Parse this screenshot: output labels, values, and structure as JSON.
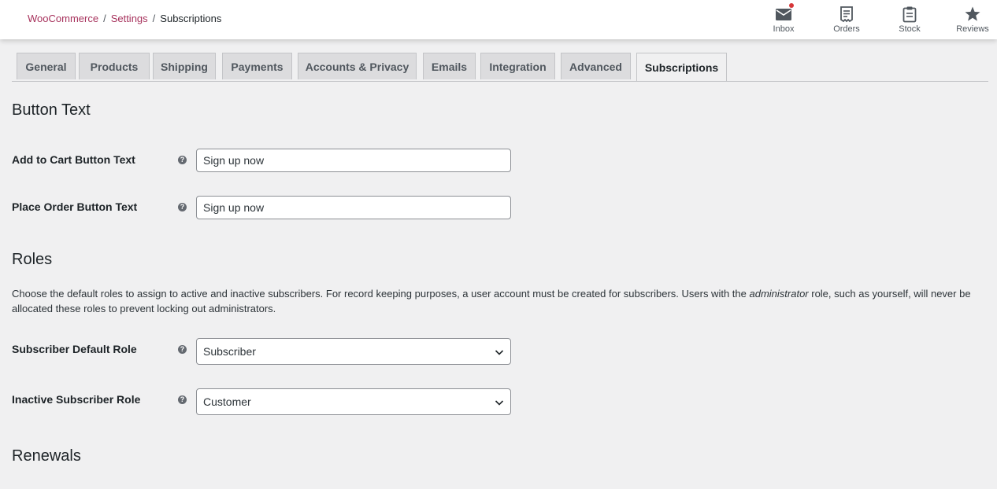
{
  "header": {
    "breadcrumb": {
      "woocommerce": "WooCommerce",
      "settings": "Settings",
      "current": "Subscriptions",
      "separator": "/"
    },
    "activity": [
      {
        "label": "Inbox",
        "icon": "inbox-icon",
        "has_unread": true
      },
      {
        "label": "Orders",
        "icon": "orders-icon"
      },
      {
        "label": "Stock",
        "icon": "stock-icon"
      },
      {
        "label": "Reviews",
        "icon": "star-icon"
      }
    ]
  },
  "tabs": [
    {
      "label": "General"
    },
    {
      "label": "Products"
    },
    {
      "label": "Shipping"
    },
    {
      "label": "Payments"
    },
    {
      "label": "Accounts & Privacy"
    },
    {
      "label": "Emails"
    },
    {
      "label": "Integration"
    },
    {
      "label": "Advanced"
    },
    {
      "label": "Subscriptions",
      "active": true
    }
  ],
  "sections": {
    "button_text": {
      "title": "Button Text",
      "add_to_cart": {
        "label": "Add to Cart Button Text",
        "value": "Sign up now"
      },
      "place_order": {
        "label": "Place Order Button Text",
        "value": "Sign up now"
      }
    },
    "roles": {
      "title": "Roles",
      "description_before": "Choose the default roles to assign to active and inactive subscribers. For record keeping purposes, a user account must be created for subscribers. Users with the ",
      "description_em": "administrator",
      "description_after": " role, such as yourself, will never be allocated these roles to prevent locking out administrators.",
      "default_role": {
        "label": "Subscriber Default Role",
        "value": "Subscriber"
      },
      "inactive_role": {
        "label": "Inactive Subscriber Role",
        "value": "Customer"
      }
    },
    "renewals": {
      "title": "Renewals"
    }
  },
  "help_glyph": "?",
  "colors": {
    "brand_link": "#a7325c",
    "background": "#f0f0f1",
    "notification_dot": "#d63638"
  }
}
